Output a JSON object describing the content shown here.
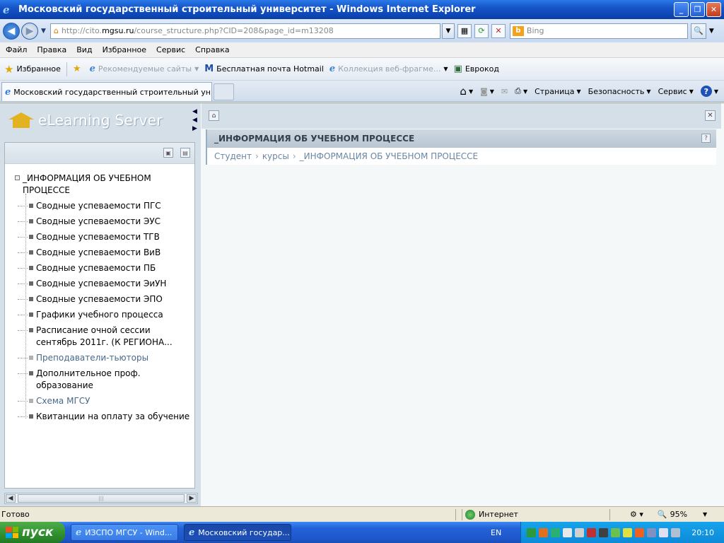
{
  "window": {
    "title": "Московский государственный строительный университет - Windows Internet Explorer"
  },
  "address": {
    "url_prefix": "http://cito.",
    "url_host": "mgsu.ru",
    "url_rest": "/course_structure.php?CID=208&page_id=m13208",
    "search_placeholder": "Bing"
  },
  "menu": {
    "items": [
      "Файл",
      "Правка",
      "Вид",
      "Избранное",
      "Сервис",
      "Справка"
    ]
  },
  "favorites": {
    "label": "Избранное",
    "items": [
      {
        "label": "Рекомендуемые сайты"
      },
      {
        "label": "Бесплатная почта Hotmail"
      },
      {
        "label": "Коллекция веб-фрагме..."
      },
      {
        "label": "Еврокод"
      }
    ]
  },
  "tab": {
    "label": "Московский государственный строительный унив..."
  },
  "commands": {
    "page": "Страница",
    "safety": "Безопасность",
    "tools": "Сервис"
  },
  "sidebar": {
    "logo_text": "eLearning Server",
    "root": "_ИНФОРМАЦИЯ ОБ УЧЕБНОМ ПРОЦЕССЕ",
    "items": [
      {
        "label": "Сводные успеваемости ПГС"
      },
      {
        "label": "Сводные успеваемости ЭУС"
      },
      {
        "label": "Сводные успеваемости ТГВ"
      },
      {
        "label": "Сводные успеваемости ВиВ"
      },
      {
        "label": "Сводные успеваемости ПБ"
      },
      {
        "label": "Сводные успеваемости ЭиУН"
      },
      {
        "label": "Сводные успеваемости ЭПО"
      },
      {
        "label": "Графики учебного процесса"
      },
      {
        "label": "Расписание очной сессии сентябрь 2011г. (К РЕГИОНА..."
      },
      {
        "label": "Преподаватели-тьюторы"
      },
      {
        "label": "Дополнительное проф. образование"
      },
      {
        "label": "Схема МГСУ"
      },
      {
        "label": "Квитанции на оплату за обучение"
      }
    ]
  },
  "main": {
    "section_title": "_ИНФОРМАЦИЯ ОБ УЧЕБНОМ ПРОЦЕССЕ",
    "breadcrumb": [
      "Студент",
      "курсы",
      "_ИНФОРМАЦИЯ ОБ УЧЕБНОМ ПРОЦЕССЕ"
    ],
    "breadcrumb_separator": "›"
  },
  "status": {
    "text": "Готово",
    "zone": "Интернет",
    "zoom": "95%"
  },
  "taskbar": {
    "start_label": "пуск",
    "items": [
      {
        "label": "ИЗСПО МГСУ - Wind..."
      },
      {
        "label": "Московский государ..."
      }
    ],
    "lang": "EN",
    "clock": "20:10"
  }
}
